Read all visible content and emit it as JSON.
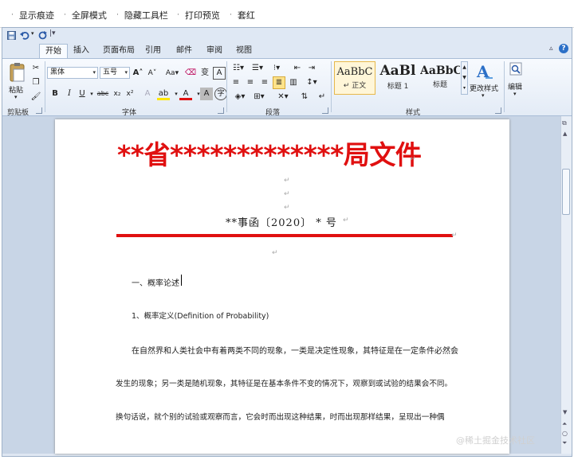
{
  "topbar": {
    "items": [
      "显示痕迹",
      "全屏模式",
      "隐藏工具栏",
      "打印预览",
      "套红"
    ]
  },
  "ribbon": {
    "tabs": [
      "开始",
      "插入",
      "页面布局",
      "引用",
      "邮件",
      "审阅",
      "视图"
    ],
    "active_tab": "开始",
    "clipboard": {
      "paste_label": "粘贴",
      "group_label": "剪贴板"
    },
    "font": {
      "font_name": "黑体",
      "font_size": "五号",
      "group_label": "字体"
    },
    "paragraph": {
      "group_label": "段落"
    },
    "styles": {
      "group_label": "样式",
      "items": [
        {
          "preview": "AaBbC",
          "name": "↵ 正文",
          "selected": true
        },
        {
          "preview": "AaBl",
          "name": "标题 1",
          "selected": false
        },
        {
          "preview": "AaBbC",
          "name": "标题",
          "selected": false
        }
      ],
      "change_styles_label": "更改样式"
    },
    "editing": {
      "label": "编辑"
    }
  },
  "document": {
    "red_header": "**省*************局文件",
    "doc_number": "**事函〔2020〕 * 号",
    "heading1": "一、概率论述",
    "heading2": "1、概率定义(Definition of Probability)",
    "lines": [
      "在自然界和人类社会中有着两类不同的现象，一类是决定性现象，其特征是在一定条件必然会",
      "发生的现象；另一类是随机现象，其特征是在基本条件不变的情况下，观察到或试验的结果会不同。",
      "换句话说，就个别的试验或观察而言，它会时而出现这种结果，时而出现那样结果，呈现出一种偶"
    ],
    "paragraph_mark": "↵"
  },
  "watermark": "@稀土掘金技术社区",
  "colors": {
    "red": "#e01010",
    "ribbon_bg": "#e3ebf6"
  }
}
